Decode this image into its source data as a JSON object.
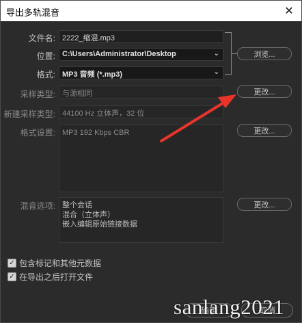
{
  "window": {
    "title": "导出多轨混音",
    "close_glyph": "✕"
  },
  "fields": {
    "filename": {
      "label": "文件名:",
      "value": "2222_缩混.mp3"
    },
    "location": {
      "label": "位置:",
      "value": "C:\\Users\\Administrator\\Desktop",
      "dropdown_glyph": "⌄"
    },
    "format": {
      "label": "格式:",
      "value": "MP3 音频 (*.mp3)",
      "dropdown_glyph": "⌄"
    },
    "sample_type": {
      "label": "采样类型:",
      "value": "与源相同"
    },
    "new_sample_type": {
      "label": "新建采样类型:",
      "value": "44100 Hz 立体声，32 位"
    },
    "format_settings": {
      "label": "格式设置:",
      "value": "MP3 192 Kbps CBR"
    },
    "mix_options": {
      "label": "混音选项:",
      "lines": [
        "整个会话",
        "混合（立体声）",
        "嵌入编辑原始链接数据"
      ]
    }
  },
  "buttons": {
    "browse": "浏览...",
    "change_sample": "更改...",
    "change_format": "更改...",
    "change_mix": "更改..."
  },
  "checkboxes": [
    {
      "label": "包含标记和其他元数据",
      "checked": true
    },
    {
      "label": "在导出之后打开文件",
      "checked": true
    }
  ],
  "check_glyph": "✓",
  "bottom": {
    "ok": "确定",
    "cancel": "取消"
  },
  "watermark": "sanlang2021",
  "colors": {
    "background": "#2b2b2b",
    "annotation_arrow": "#e8352b"
  }
}
